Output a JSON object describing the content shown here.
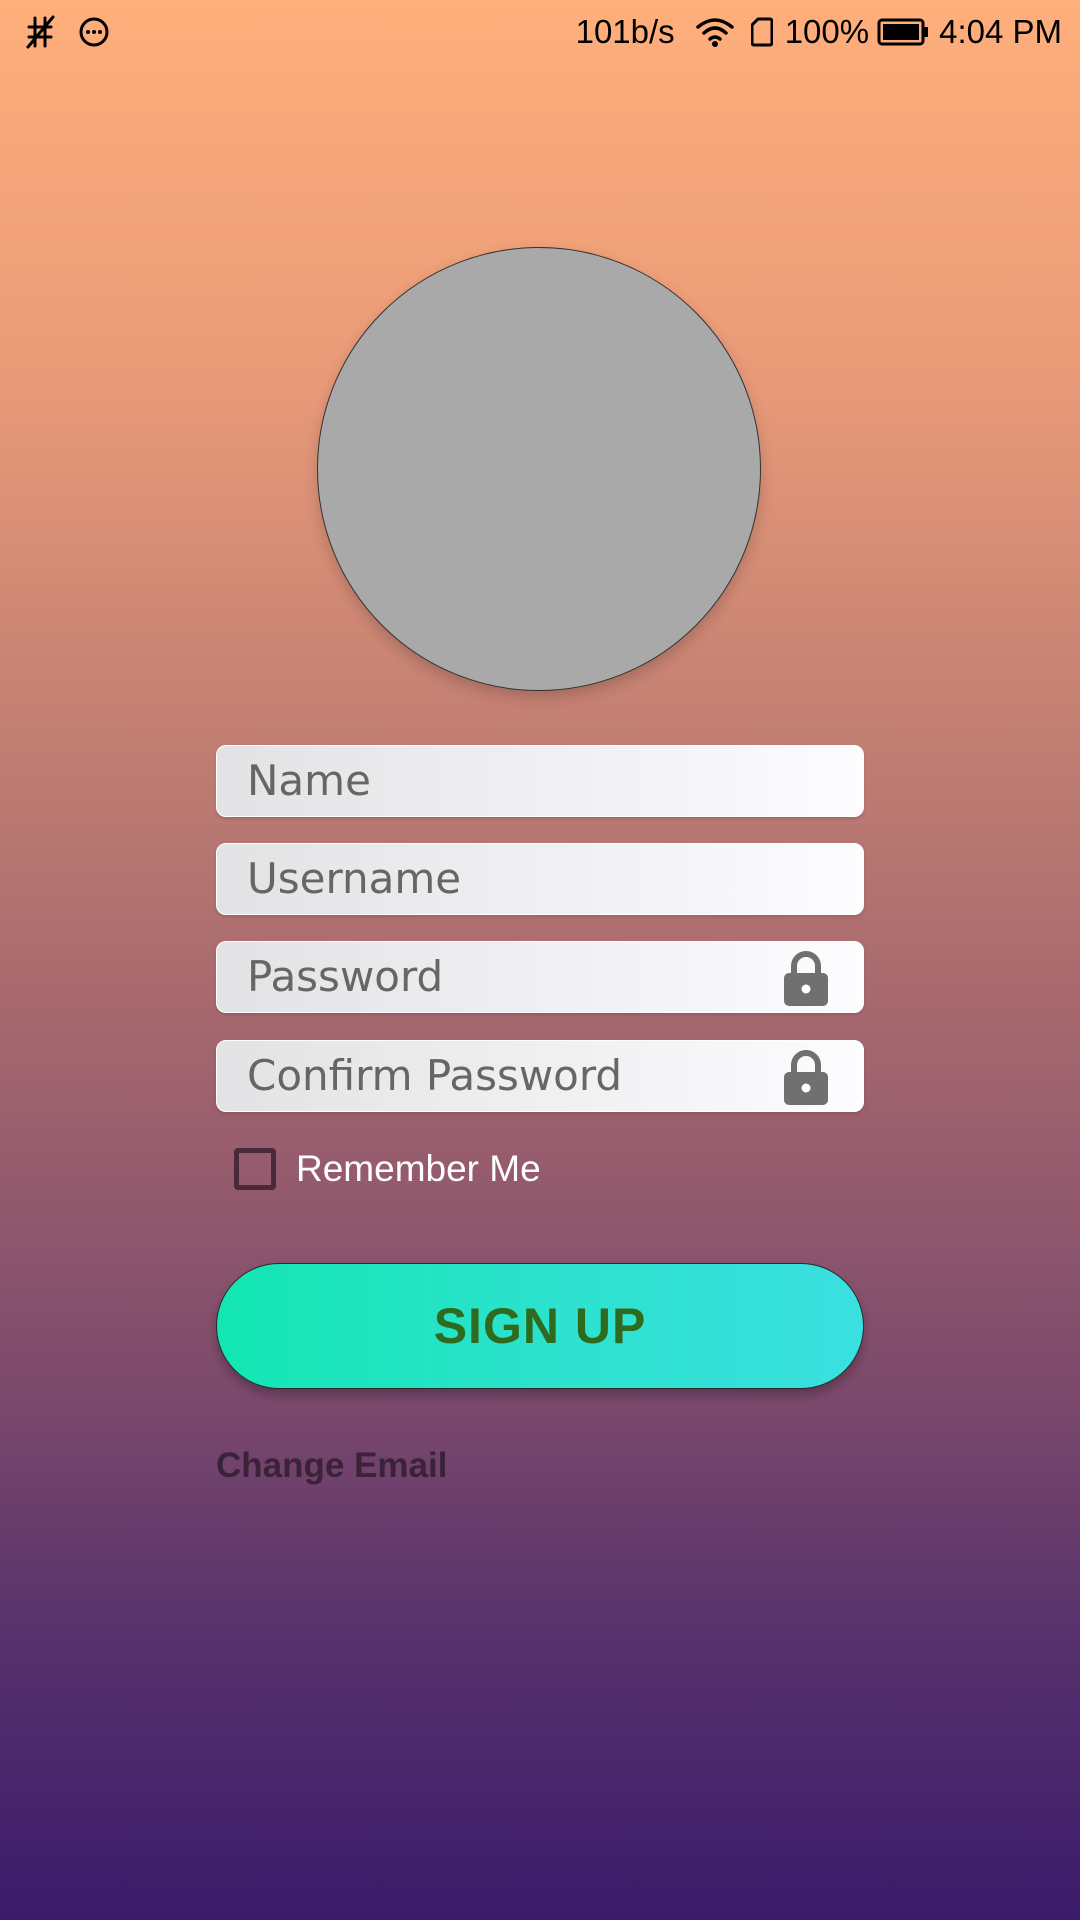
{
  "status_bar": {
    "left_icons": [
      "no-sim-signal-icon",
      "message-dots-icon"
    ],
    "network_speed": "101b/s",
    "battery_percent": "100%",
    "time": "4:04 PM",
    "right_icons": [
      "wifi-icon",
      "sim-card-icon",
      "battery-icon"
    ]
  },
  "avatar": {
    "icon": "profile-photo-placeholder",
    "color": "#a9a9a9"
  },
  "form": {
    "name": {
      "value": "",
      "placeholder": "Name"
    },
    "username": {
      "value": "",
      "placeholder": "Username"
    },
    "password": {
      "value": "",
      "placeholder": "Password",
      "icon": "lock-icon"
    },
    "confirm_password": {
      "value": "",
      "placeholder": "Confirm Password",
      "icon": "lock-icon"
    },
    "remember_me": {
      "label": "Remember Me",
      "checked": false
    }
  },
  "signup_button": {
    "label": "SIGN UP",
    "text_color": "#2f6b1e"
  },
  "change_email_link": {
    "label": "Change Email"
  },
  "colors": {
    "background_top": "#ffaf7b",
    "background_bottom": "#3b1b6b",
    "button_start": "#12e6b2",
    "button_end": "#3ae0e0"
  }
}
